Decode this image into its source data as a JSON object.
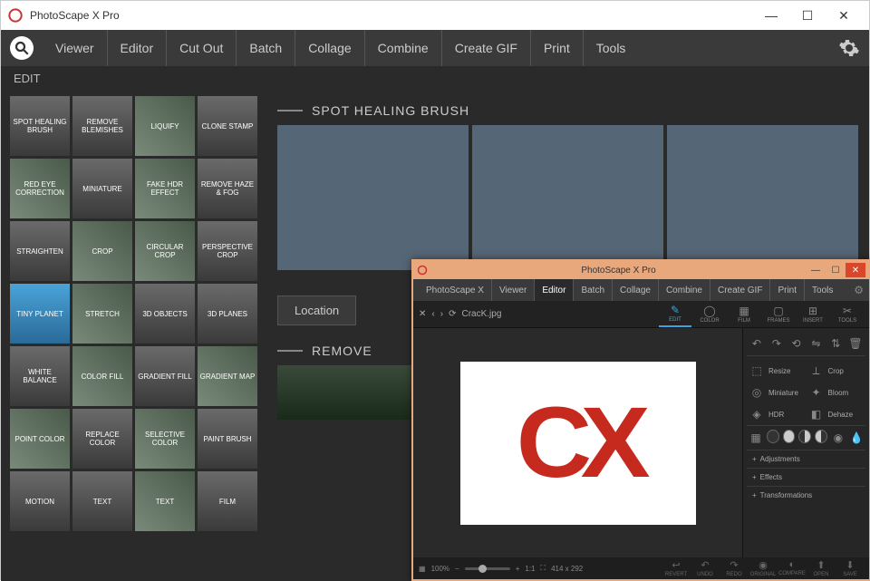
{
  "outer": {
    "title": "PhotoScape X Pro",
    "menu": [
      "Viewer",
      "Editor",
      "Cut Out",
      "Batch",
      "Collage",
      "Combine",
      "Create GIF",
      "Print",
      "Tools"
    ],
    "edit_label": "EDIT",
    "tiles": [
      "SPOT HEALING BRUSH",
      "REMOVE BLEMISHES",
      "LIQUIFY",
      "CLONE STAMP",
      "RED EYE CORRECTION",
      "MINIATURE",
      "FAKE HDR EFFECT",
      "REMOVE HAZE & FOG",
      "STRAIGHTEN",
      "CROP",
      "CIRCULAR CROP",
      "PERSPECTIVE CROP",
      "TINY PLANET",
      "STRETCH",
      "3D OBJECTS",
      "3D PLANES",
      "WHITE BALANCE",
      "COLOR FILL",
      "GRADIENT FILL",
      "GRADIENT MAP",
      "POINT COLOR",
      "REPLACE COLOR",
      "SELECTIVE COLOR",
      "PAINT BRUSH",
      "MOTION",
      "TEXT",
      "TEXT",
      "FILM"
    ],
    "section1": "SPOT HEALING BRUSH",
    "location_btn": "Location",
    "section2": "REMOVE"
  },
  "win2": {
    "title": "PhotoScape X Pro",
    "menu": [
      "PhotoScape X",
      "Viewer",
      "Editor",
      "Batch",
      "Collage",
      "Combine",
      "Create GIF",
      "Print",
      "Tools"
    ],
    "active_menu": "Editor",
    "filename": "CracK.jpg",
    "toolbar_icons": [
      {
        "label": "EDIT",
        "icon": "✎"
      },
      {
        "label": "COLOR",
        "icon": "◯"
      },
      {
        "label": "FILM",
        "icon": "▦"
      },
      {
        "label": "FRAMES",
        "icon": "▢"
      },
      {
        "label": "INSERT",
        "icon": "⊞"
      },
      {
        "label": "TOOLS",
        "icon": "✂"
      }
    ],
    "rpanel_tools": [
      {
        "icon": "⬚",
        "label": "Resize"
      },
      {
        "icon": "⟂",
        "label": "Crop"
      },
      {
        "icon": "◎",
        "label": "Miniature"
      },
      {
        "icon": "✦",
        "label": "Bloom"
      },
      {
        "icon": "◈",
        "label": "HDR"
      },
      {
        "icon": "◧",
        "label": "Dehaze"
      }
    ],
    "accordion": [
      "Adjustments",
      "Effects",
      "Transformations"
    ],
    "status": {
      "zoom": "100%",
      "ratio": "1:1",
      "dims": "414 x 292"
    },
    "status_btns": [
      "REVERT",
      "UNDO",
      "REDO",
      "ORIGINAL",
      "COMPARE",
      "OPEN",
      "SAVE"
    ]
  }
}
